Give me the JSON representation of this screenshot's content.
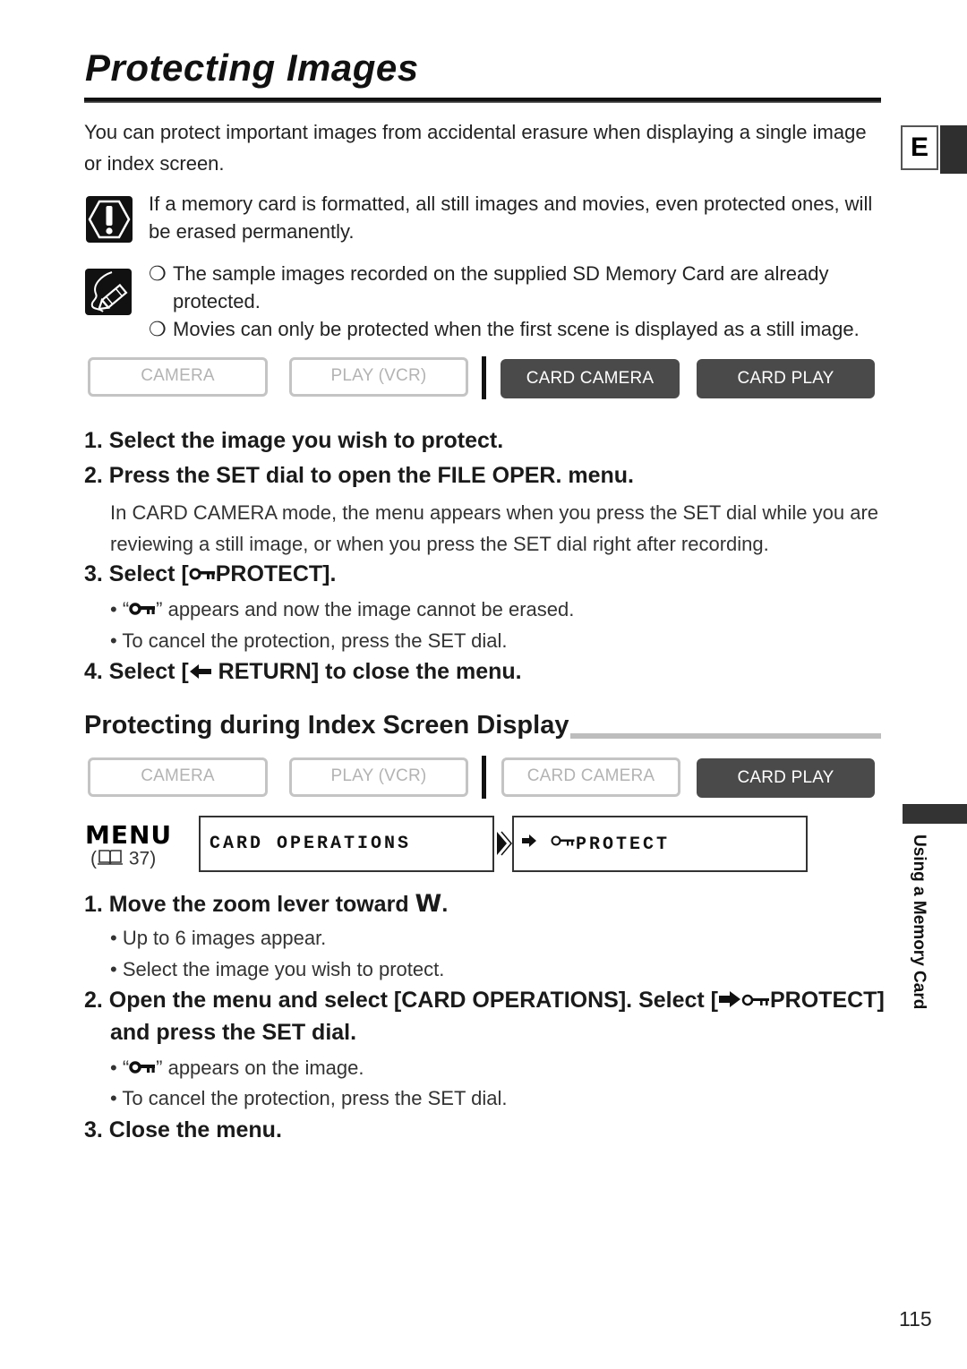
{
  "page": {
    "title": "Protecting Images",
    "language_tab": "E",
    "intro": "You can protect important images from accidental erasure when displaying a single image or index screen.",
    "caution_icon": "caution-icon",
    "caution": "If a memory card is formatted, all still images and movies, even protected ones, will be erased permanently.",
    "memo_icon": "memo-pencil-icon",
    "notes": [
      {
        "bullet": "❍",
        "text": "The sample images recorded on the supplied SD Memory Card are already protected."
      },
      {
        "bullet": "❍",
        "text": "Movies can only be protected when the first scene is displayed as a still image."
      }
    ],
    "side_label": "Using a Memory Card",
    "page_number": "115"
  },
  "section1": {
    "modes": [
      {
        "label": "CAMERA",
        "active": false
      },
      {
        "label": "PLAY (VCR)",
        "active": false
      },
      {
        "label": "CARD CAMERA",
        "active": true
      },
      {
        "label": "CARD PLAY",
        "active": true
      }
    ],
    "steps": {
      "s1": "1. Select the image you wish to protect.",
      "s2": "2. Press the SET dial to open the FILE OPER. menu.",
      "s2_detail": "In CARD CAMERA mode, the menu appears when you press the SET dial while you are reviewing a still image, or when you press the SET dial right after recording.",
      "s3_prefix": "3. Select [",
      "s3_suffix": "PROTECT].",
      "s3_b1_prefix": "• “",
      "s3_b1_suffix": "” appears and now the image cannot be erased.",
      "s3_b2": "• To cancel the protection, press the SET dial.",
      "s4_prefix": "4. Select [",
      "s4_suffix": " RETURN] to close the menu."
    }
  },
  "section2": {
    "title": "Protecting during Index Screen Display",
    "modes": [
      {
        "label": "CAMERA",
        "active": false
      },
      {
        "label": "PLAY (VCR)",
        "active": false
      },
      {
        "label": "CARD CAMERA",
        "active": false
      },
      {
        "label": "CARD PLAY",
        "active": true
      }
    ],
    "menu": {
      "label": "MENU",
      "ref_open": "(",
      "ref_page": "37)",
      "box1": "CARD OPERATIONS",
      "box2": "PROTECT"
    },
    "steps": {
      "s1_prefix": "1. Move the zoom lever toward ",
      "s1_w": "W",
      "s1_suffix": ".",
      "s1_b1": "• Up to 6 images appear.",
      "s1_b2": "• Select the image you wish to protect.",
      "s2_line1_prefix": "2. Open the menu and select [CARD OPERATIONS]. Select [",
      "s2_line1_suffix": "PROTECT]",
      "s2_line2": "and press the SET dial.",
      "s2_b1_prefix": "• “",
      "s2_b1_suffix": "” appears on the image.",
      "s2_b2": "• To cancel the protection, press the SET dial.",
      "s3": "3. Close the menu."
    }
  }
}
